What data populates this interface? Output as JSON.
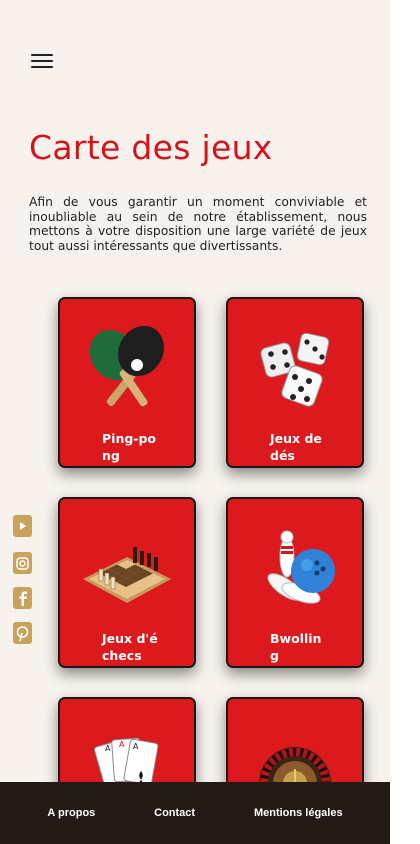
{
  "page": {
    "title": "Carte des jeux",
    "intro": "Afin de vous garantir un moment conviviable et inoubliable au sein de notre établissement, nous mettons à votre disposition une large variété de jeux tout aussi intéressants que divertissants."
  },
  "games": [
    {
      "label": "Ping-pong",
      "icon": "ping-pong-icon"
    },
    {
      "label": "Jeux de dés",
      "icon": "dice-icon"
    },
    {
      "label": "Jeux d'échecs",
      "icon": "chess-icon"
    },
    {
      "label": "Bwolling",
      "icon": "bowling-icon"
    },
    {
      "label": "",
      "icon": "cards-icon"
    },
    {
      "label": "",
      "icon": "roulette-icon"
    }
  ],
  "social": [
    "youtube-icon",
    "instagram-icon",
    "facebook-icon",
    "pinterest-icon"
  ],
  "footer": {
    "about": "A propos",
    "contact": "Contact",
    "legal": "Mentions légales"
  },
  "colors": {
    "accent": "#d4141a",
    "card": "#dc1a1e",
    "background": "#f7f2ed",
    "footer": "#221a16",
    "social": "#c9a25c"
  }
}
